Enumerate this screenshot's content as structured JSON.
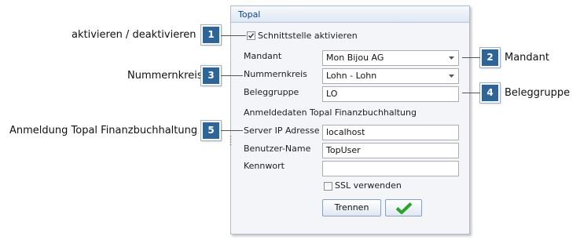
{
  "window": {
    "title": "Topal"
  },
  "form": {
    "checkbox_activate": {
      "label": "Schnittstelle aktivieren",
      "checked": true
    },
    "mandant": {
      "label": "Mandant",
      "value": "Mon Bijou AG"
    },
    "nummernkreis": {
      "label": "Nummernkreis",
      "value": "Lohn - Lohn"
    },
    "beleggruppe": {
      "label": "Beleggruppe",
      "value": "LO"
    },
    "section_heading": "Anmeldedaten Topal Finanzbuchhaltung",
    "server": {
      "label": "Server IP Adresse",
      "value": "localhost"
    },
    "username": {
      "label": "Benutzer-Name",
      "value": "TopUser"
    },
    "password": {
      "label": "Kennwort",
      "value": ""
    },
    "ssl": {
      "label": "SSL verwenden",
      "checked": false
    },
    "disconnect_button": "Trennen",
    "confirm_icon": "checkmark-icon"
  },
  "callouts": [
    {
      "number": "1",
      "text": "aktivieren / deaktivieren"
    },
    {
      "number": "2",
      "text": "Mandant"
    },
    {
      "number": "3",
      "text": "Nummernkreis"
    },
    {
      "number": "4",
      "text": "Beleggruppe"
    },
    {
      "number": "5",
      "text": "Anmeldung Topal Finanzbuchhaltung"
    }
  ],
  "colors": {
    "badge": "#2e6496",
    "title_text": "#15428b",
    "check_green": "#2aa32a"
  }
}
